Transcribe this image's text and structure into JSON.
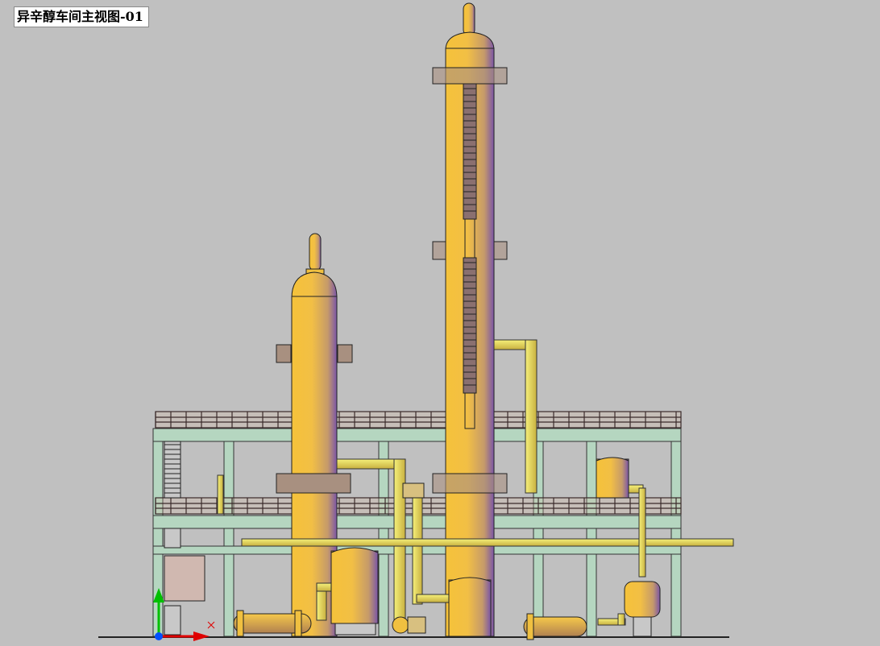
{
  "drawing": {
    "title": "异辛醇车间主视图-01"
  },
  "colors": {
    "background": "#c0c0c0",
    "vessel": "#f0c040",
    "vessel_shade": "#8a5fa0",
    "steel_frame": "#b5d6c0",
    "railing": "#3a2a2a",
    "pipe": "#f0e060",
    "ucs_y": "#00c000",
    "ucs_x": "#e00000",
    "ucs_origin": "#0050ff"
  },
  "ucs_icon": {
    "x_axis": "x-axis",
    "y_axis": "y-axis"
  }
}
